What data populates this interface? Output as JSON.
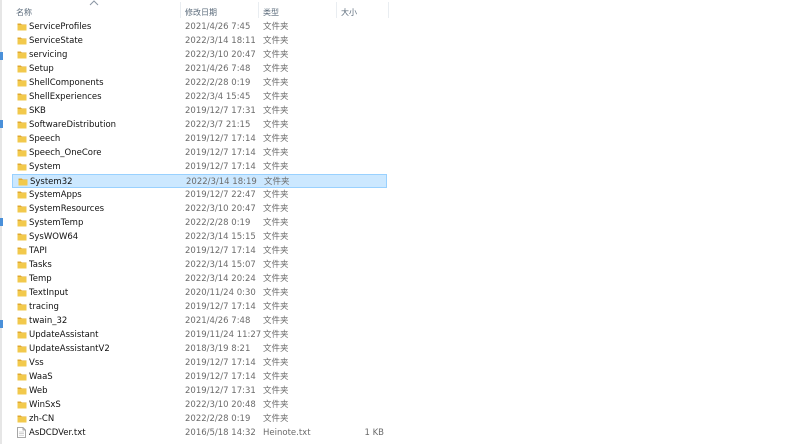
{
  "header": {
    "name_label": "名称",
    "date_label": "修改日期",
    "type_label": "类型",
    "size_label": "大小"
  },
  "colors": {
    "folder": "#f2c94c",
    "folder_dark": "#e0a82e",
    "selected_bg": "#cce8ff",
    "selected_border": "#99d1ff"
  },
  "files": [
    {
      "name": "ServiceProfiles",
      "date": "2021/4/26 7:45",
      "type": "文件夹",
      "size": "",
      "icon": "folder-icon"
    },
    {
      "name": "ServiceState",
      "date": "2022/3/14 18:11",
      "type": "文件夹",
      "size": "",
      "icon": "folder-icon"
    },
    {
      "name": "servicing",
      "date": "2022/3/10 20:47",
      "type": "文件夹",
      "size": "",
      "icon": "folder-icon"
    },
    {
      "name": "Setup",
      "date": "2021/4/26 7:48",
      "type": "文件夹",
      "size": "",
      "icon": "folder-icon"
    },
    {
      "name": "ShellComponents",
      "date": "2022/2/28 0:19",
      "type": "文件夹",
      "size": "",
      "icon": "folder-icon"
    },
    {
      "name": "ShellExperiences",
      "date": "2022/3/4 15:45",
      "type": "文件夹",
      "size": "",
      "icon": "folder-icon"
    },
    {
      "name": "SKB",
      "date": "2019/12/7 17:31",
      "type": "文件夹",
      "size": "",
      "icon": "folder-icon"
    },
    {
      "name": "SoftwareDistribution",
      "date": "2022/3/7 21:15",
      "type": "文件夹",
      "size": "",
      "icon": "folder-icon"
    },
    {
      "name": "Speech",
      "date": "2019/12/7 17:14",
      "type": "文件夹",
      "size": "",
      "icon": "folder-icon"
    },
    {
      "name": "Speech_OneCore",
      "date": "2019/12/7 17:14",
      "type": "文件夹",
      "size": "",
      "icon": "folder-icon"
    },
    {
      "name": "System",
      "date": "2019/12/7 17:14",
      "type": "文件夹",
      "size": "",
      "icon": "folder-icon"
    },
    {
      "name": "System32",
      "date": "2022/3/14 18:19",
      "type": "文件夹",
      "size": "",
      "icon": "folder-icon",
      "selected": true
    },
    {
      "name": "SystemApps",
      "date": "2019/12/7 22:47",
      "type": "文件夹",
      "size": "",
      "icon": "folder-icon"
    },
    {
      "name": "SystemResources",
      "date": "2022/3/10 20:47",
      "type": "文件夹",
      "size": "",
      "icon": "folder-icon"
    },
    {
      "name": "SystemTemp",
      "date": "2022/2/28 0:19",
      "type": "文件夹",
      "size": "",
      "icon": "folder-icon"
    },
    {
      "name": "SysWOW64",
      "date": "2022/3/14 15:15",
      "type": "文件夹",
      "size": "",
      "icon": "folder-icon"
    },
    {
      "name": "TAPI",
      "date": "2019/12/7 17:14",
      "type": "文件夹",
      "size": "",
      "icon": "folder-icon"
    },
    {
      "name": "Tasks",
      "date": "2022/3/14 15:07",
      "type": "文件夹",
      "size": "",
      "icon": "folder-icon"
    },
    {
      "name": "Temp",
      "date": "2022/3/14 20:24",
      "type": "文件夹",
      "size": "",
      "icon": "folder-icon"
    },
    {
      "name": "TextInput",
      "date": "2020/11/24 0:30",
      "type": "文件夹",
      "size": "",
      "icon": "folder-icon"
    },
    {
      "name": "tracing",
      "date": "2019/12/7 17:14",
      "type": "文件夹",
      "size": "",
      "icon": "folder-icon"
    },
    {
      "name": "twain_32",
      "date": "2021/4/26 7:48",
      "type": "文件夹",
      "size": "",
      "icon": "folder-icon"
    },
    {
      "name": "UpdateAssistant",
      "date": "2019/11/24 11:27",
      "type": "文件夹",
      "size": "",
      "icon": "folder-icon"
    },
    {
      "name": "UpdateAssistantV2",
      "date": "2018/3/19 8:21",
      "type": "文件夹",
      "size": "",
      "icon": "folder-icon"
    },
    {
      "name": "Vss",
      "date": "2019/12/7 17:14",
      "type": "文件夹",
      "size": "",
      "icon": "folder-icon"
    },
    {
      "name": "WaaS",
      "date": "2019/12/7 17:14",
      "type": "文件夹",
      "size": "",
      "icon": "folder-icon"
    },
    {
      "name": "Web",
      "date": "2019/12/7 17:31",
      "type": "文件夹",
      "size": "",
      "icon": "folder-icon"
    },
    {
      "name": "WinSxS",
      "date": "2022/3/10 20:48",
      "type": "文件夹",
      "size": "",
      "icon": "folder-icon"
    },
    {
      "name": "zh-CN",
      "date": "2022/2/28 0:19",
      "type": "文件夹",
      "size": "",
      "icon": "folder-icon"
    },
    {
      "name": "AsDCDVer.txt",
      "date": "2016/5/18 14:32",
      "type": "Heinote.txt",
      "size": "1 KB",
      "icon": "text-file-icon"
    }
  ]
}
